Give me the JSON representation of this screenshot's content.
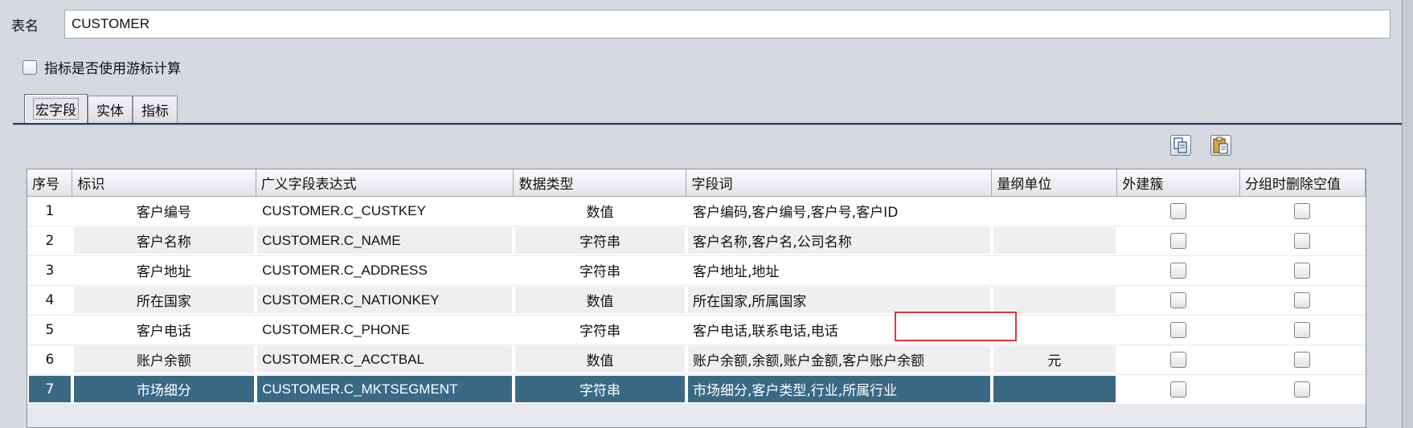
{
  "form": {
    "table_name_label": "表名",
    "table_name_value": "CUSTOMER",
    "cursor_checkbox_label": "指标是否使用游标计算",
    "cursor_checkbox_checked": false
  },
  "tabs": [
    {
      "label": "宏字段",
      "active": true
    },
    {
      "label": "实体",
      "active": false
    },
    {
      "label": "指标",
      "active": false
    }
  ],
  "toolbar": {
    "copy_icon": "copy-icon",
    "paste_icon": "paste-icon"
  },
  "table": {
    "columns": [
      "序号",
      "标识",
      "广义字段表达式",
      "数据类型",
      "字段词",
      "量纲单位",
      "外建簇",
      "分组时删除空值"
    ],
    "rows": [
      {
        "no": "1",
        "id": "客户编号",
        "expr": "CUSTOMER.C_CUSTKEY",
        "type": "数值",
        "words": "客户编码,客户编号,客户号,客户ID",
        "unit": "",
        "fk": false,
        "drop_null": false
      },
      {
        "no": "2",
        "id": "客户名称",
        "expr": "CUSTOMER.C_NAME",
        "type": "字符串",
        "words": "客户名称,客户名,公司名称",
        "unit": "",
        "fk": false,
        "drop_null": false
      },
      {
        "no": "3",
        "id": "客户地址",
        "expr": "CUSTOMER.C_ADDRESS",
        "type": "字符串",
        "words": "客户地址,地址",
        "unit": "",
        "fk": false,
        "drop_null": false
      },
      {
        "no": "4",
        "id": "所在国家",
        "expr": "CUSTOMER.C_NATIONKEY",
        "type": "数值",
        "words": "所在国家,所属国家",
        "unit": "",
        "fk": false,
        "drop_null": false
      },
      {
        "no": "5",
        "id": "客户电话",
        "expr": "CUSTOMER.C_PHONE",
        "type": "字符串",
        "words": "客户电话,联系电话,电话",
        "unit": "",
        "fk": false,
        "drop_null": false
      },
      {
        "no": "6",
        "id": "账户余额",
        "expr": "CUSTOMER.C_ACCTBAL",
        "type": "数值",
        "words": "账户余额,余额,账户金额,客户账户余额",
        "unit": "元",
        "fk": false,
        "drop_null": false
      },
      {
        "no": "7",
        "id": "市场细分",
        "expr": "CUSTOMER.C_MKTSEGMENT",
        "type": "字符串",
        "words": "市场细分,客户类型,行业,所属行业",
        "unit": "",
        "fk": false,
        "drop_null": false
      }
    ],
    "selected_row": "7"
  },
  "colors": {
    "selection": "#3a6986",
    "highlight_border": "#e0363a"
  }
}
